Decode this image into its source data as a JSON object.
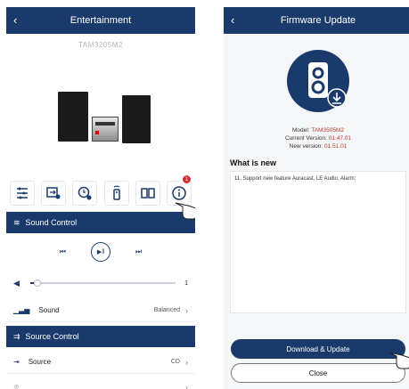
{
  "left": {
    "header": {
      "title": "Entertainment",
      "back": "‹"
    },
    "model_name": "TAM3205M2",
    "tabs": [
      {
        "icon": "equalizer-icon"
      },
      {
        "icon": "source-settings-icon"
      },
      {
        "icon": "timer-settings-icon"
      },
      {
        "icon": "remote-icon"
      },
      {
        "icon": "book-icon"
      },
      {
        "icon": "info-icon"
      }
    ],
    "notification_count": "1",
    "sound_control": {
      "title": "Sound Control"
    },
    "volume": {
      "value": "1",
      "level": 0.05
    },
    "sound_row": {
      "label": "Sound",
      "value": "Balanced"
    },
    "source_control": {
      "title": "Source Control"
    },
    "source_row": {
      "label": "Source",
      "value": "CD"
    }
  },
  "right": {
    "header": {
      "title": "Firmware Update",
      "back": "‹"
    },
    "model_label": "Model:",
    "model_value": "TAM3505M2",
    "current_label": "Current Version:",
    "current_value": "01.47.01",
    "new_label": "New version:",
    "new_value": "01.51.01",
    "whats_new_title": "What is new",
    "notes": "11, Support new feature Auracast, LE Audio, Alarm;",
    "download_button": "Download & Update",
    "close_button": "Close"
  },
  "colors": {
    "brand": "#1a3a6b",
    "badge": "#d62f2f"
  }
}
